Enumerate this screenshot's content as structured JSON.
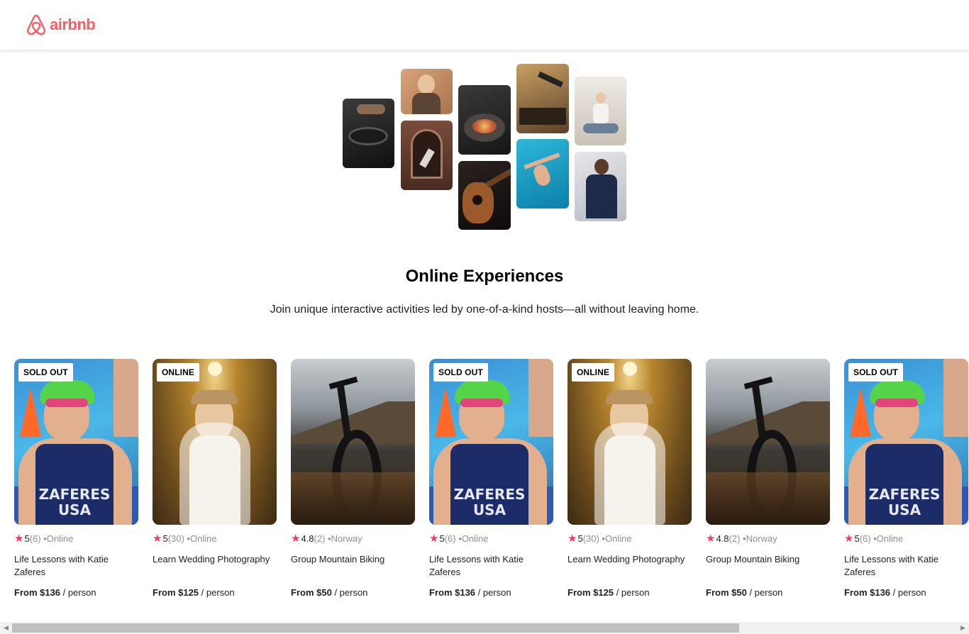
{
  "brand": {
    "name": "airbnb",
    "color": "#FF5A5F"
  },
  "hero": {
    "title": "Online Experiences",
    "subtitle": "Join unique interactive activities led by one-of-a-kind hosts—all without leaving home."
  },
  "hero_photos": [
    {
      "subject": "cooking"
    },
    {
      "subject": "woman-smiling"
    },
    {
      "subject": "dancer"
    },
    {
      "subject": "food-bowl"
    },
    {
      "subject": "guitar"
    },
    {
      "subject": "singer"
    },
    {
      "subject": "swimmer"
    },
    {
      "subject": "yoga"
    },
    {
      "subject": "musician"
    }
  ],
  "cards": [
    {
      "badge": "SOLD OUT",
      "rating": "5",
      "reviews": "(6)",
      "location": "Online",
      "title": "Life Lessons with Katie Zaferes",
      "price": "From $136",
      "unit": "/ person",
      "photo": "triathlete"
    },
    {
      "badge": "ONLINE",
      "rating": "5",
      "reviews": "(30)",
      "location": "Online",
      "title": "Learn Wedding Photography",
      "price": "From $125",
      "unit": "/ person",
      "photo": "bride"
    },
    {
      "badge": "",
      "rating": "4.8",
      "reviews": "(2)",
      "location": "Norway",
      "title": "Group Mountain Biking",
      "price": "From $50",
      "unit": "/ person",
      "photo": "bike"
    },
    {
      "badge": "SOLD OUT",
      "rating": "5",
      "reviews": "(6)",
      "location": "Online",
      "title": "Life Lessons with Katie Zaferes",
      "price": "From $136",
      "unit": "/ person",
      "photo": "triathlete"
    },
    {
      "badge": "ONLINE",
      "rating": "5",
      "reviews": "(30)",
      "location": "Online",
      "title": "Learn Wedding Photography",
      "price": "From $125",
      "unit": "/ person",
      "photo": "bride"
    },
    {
      "badge": "",
      "rating": "4.8",
      "reviews": "(2)",
      "location": "Norway",
      "title": "Group Mountain Biking",
      "price": "From $50",
      "unit": "/ person",
      "photo": "bike"
    },
    {
      "badge": "SOLD OUT",
      "rating": "5",
      "reviews": "(6)",
      "location": "Online",
      "title": "Life Lessons with Katie Zaferes",
      "price": "From $136",
      "unit": "/ person",
      "photo": "triathlete"
    }
  ],
  "colors": {
    "star": "#FE385C",
    "muted": "#918E9B"
  },
  "icons": {
    "star": "star-icon",
    "logo": "airbnb-logo-icon"
  }
}
